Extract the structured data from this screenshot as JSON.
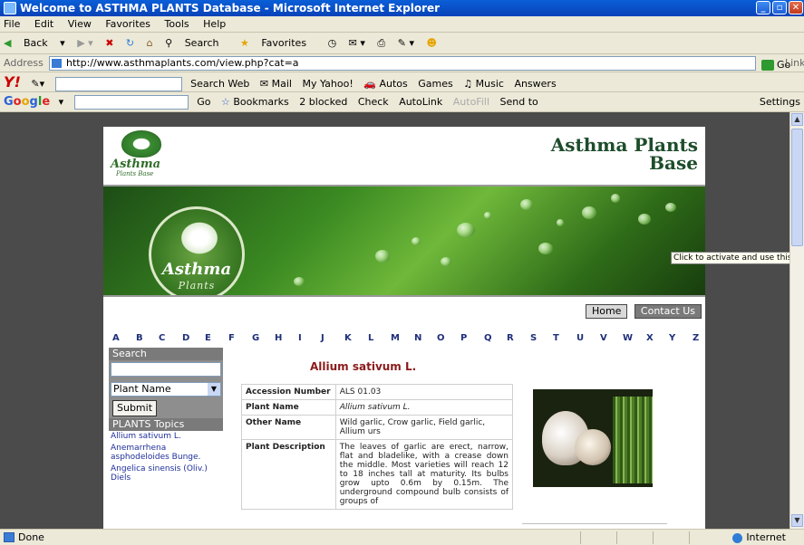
{
  "window": {
    "title": "Welcome to ASTHMA PLANTS Database - Microsoft Internet Explorer"
  },
  "menu": [
    "File",
    "Edit",
    "View",
    "Favorites",
    "Tools",
    "Help"
  ],
  "toolbar": {
    "back": "Back",
    "search": "Search",
    "favorites": "Favorites"
  },
  "address": {
    "label": "Address",
    "url": "http://www.asthmaplants.com/view.php?cat=a",
    "go": "Go",
    "links": "Links"
  },
  "yahoo": {
    "logo": "Y!",
    "search_web": "Search Web",
    "mail": "Mail",
    "my_yahoo": "My Yahoo!",
    "autos": "Autos",
    "games": "Games",
    "music": "Music",
    "answers": "Answers"
  },
  "google": {
    "logo": "Google",
    "go": "Go",
    "bookmarks": "Bookmarks",
    "blocked": "2 blocked",
    "check": "Check",
    "autolink": "AutoLink",
    "autofill": "AutoFill",
    "send_to": "Send to",
    "settings": "Settings"
  },
  "site": {
    "small_logo": "Asthma",
    "small_logo_sub": "Plants Base",
    "brand_line1": "Asthma Plants",
    "brand_line2": "Base",
    "seal_title": "Asthma",
    "seal_sub": "Plants",
    "nav": {
      "home": "Home",
      "contact": "Contact Us"
    },
    "alphabet": [
      "A",
      "B",
      "C",
      "D",
      "E",
      "F",
      "G",
      "H",
      "I",
      "J",
      "K",
      "L",
      "M",
      "N",
      "O",
      "P",
      "Q",
      "R",
      "S",
      "T",
      "U",
      "V",
      "W",
      "X",
      "Y",
      "Z"
    ],
    "search_heading": "Search",
    "select_value": "Plant Name",
    "submit": "Submit",
    "topics_heading": "PLANTS Topics",
    "topics": [
      "Allium sativum L.",
      "Anemarrhena asphodeloides Bunge.",
      "Angelica sinensis (Oliv.) Diels"
    ],
    "plant_title": "Allium sativum L.",
    "table": [
      {
        "label": "Accession Number",
        "value": "ALS 01.03"
      },
      {
        "label": "Plant Name",
        "value": "Allium sativum L."
      },
      {
        "label": "Other Name",
        "value": "Wild garlic, Crow garlic, Field garlic, Allium urs"
      },
      {
        "label": "Plant Description",
        "value": "The leaves of garlic are erect, narrow, flat and bladelike, with a crease down the middle. Most varieties will reach 12 to 18 inches tall at maturity. Its bulbs grow upto 0.6m by 0.15m. The underground compound bulb consists of groups of"
      }
    ]
  },
  "tooltip": "Click to activate and use this contro",
  "status": {
    "text": "Done",
    "zone": "Internet"
  }
}
